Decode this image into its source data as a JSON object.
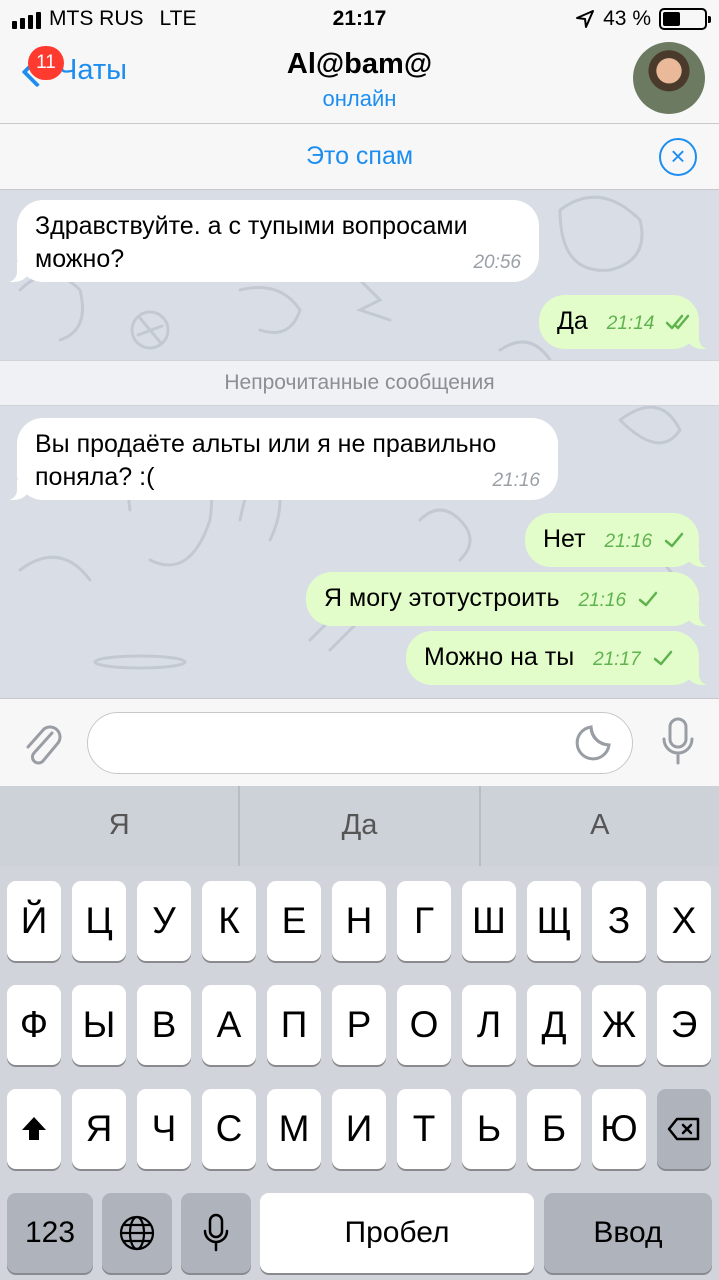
{
  "status_bar": {
    "carrier": "MTS RUS",
    "network": "LTE",
    "time": "21:17",
    "battery": "43 %",
    "battery_level": 0.43
  },
  "nav": {
    "back_label": "Чаты",
    "badge": "11",
    "title": "Al@bam@",
    "subtitle": "онлайн",
    "avatar_icon": "user-avatar"
  },
  "spam_bar": {
    "label": "Это спам",
    "close_icon": "close-circle-icon"
  },
  "messages": [
    {
      "direction": "in",
      "line1": "Здравствуйте. а с тупыми вопросами",
      "line2": "можно?",
      "time": "20:56"
    },
    {
      "direction": "out",
      "text": "Да",
      "time": "21:14",
      "status": "read"
    },
    {
      "direction": "in",
      "line1": "Вы продаёте альты или я не правильно",
      "line2": "поняла? :(",
      "time": "21:16"
    },
    {
      "direction": "out",
      "text": "Нет",
      "time": "21:16",
      "status": "sent"
    },
    {
      "direction": "out",
      "text": "Я могу этотустроить",
      "time": "21:16",
      "status": "sent"
    },
    {
      "direction": "out",
      "text": "Можно на ты",
      "time": "21:17",
      "status": "sent"
    }
  ],
  "unread_divider": "Непрочитанные сообщения",
  "input": {
    "value": "",
    "attach_icon": "paperclip-icon",
    "sticker_icon": "sticker-icon",
    "mic_icon": "microphone-icon"
  },
  "predictions": [
    "Я",
    "Да",
    "А"
  ],
  "keyboard": {
    "row1": [
      "Й",
      "Ц",
      "У",
      "К",
      "Е",
      "Н",
      "Г",
      "Ш",
      "Щ",
      "З",
      "Х"
    ],
    "row2": [
      "Ф",
      "Ы",
      "В",
      "А",
      "П",
      "Р",
      "О",
      "Л",
      "Д",
      "Ж",
      "Э"
    ],
    "row3": [
      "Я",
      "Ч",
      "С",
      "М",
      "И",
      "Т",
      "Ь",
      "Б",
      "Ю"
    ],
    "numbers": "123",
    "space": "Пробел",
    "return": "Ввод",
    "shift_icon": "shift-icon",
    "backspace_icon": "backspace-icon",
    "globe_icon": "globe-icon",
    "dictation_icon": "microphone-icon"
  },
  "colors": {
    "accent": "#1d8ef0",
    "outgoing_bubble": "#e2fdc9",
    "incoming_bubble": "#ffffff",
    "chat_background": "#d9dee6",
    "badge": "#ff3b30"
  }
}
